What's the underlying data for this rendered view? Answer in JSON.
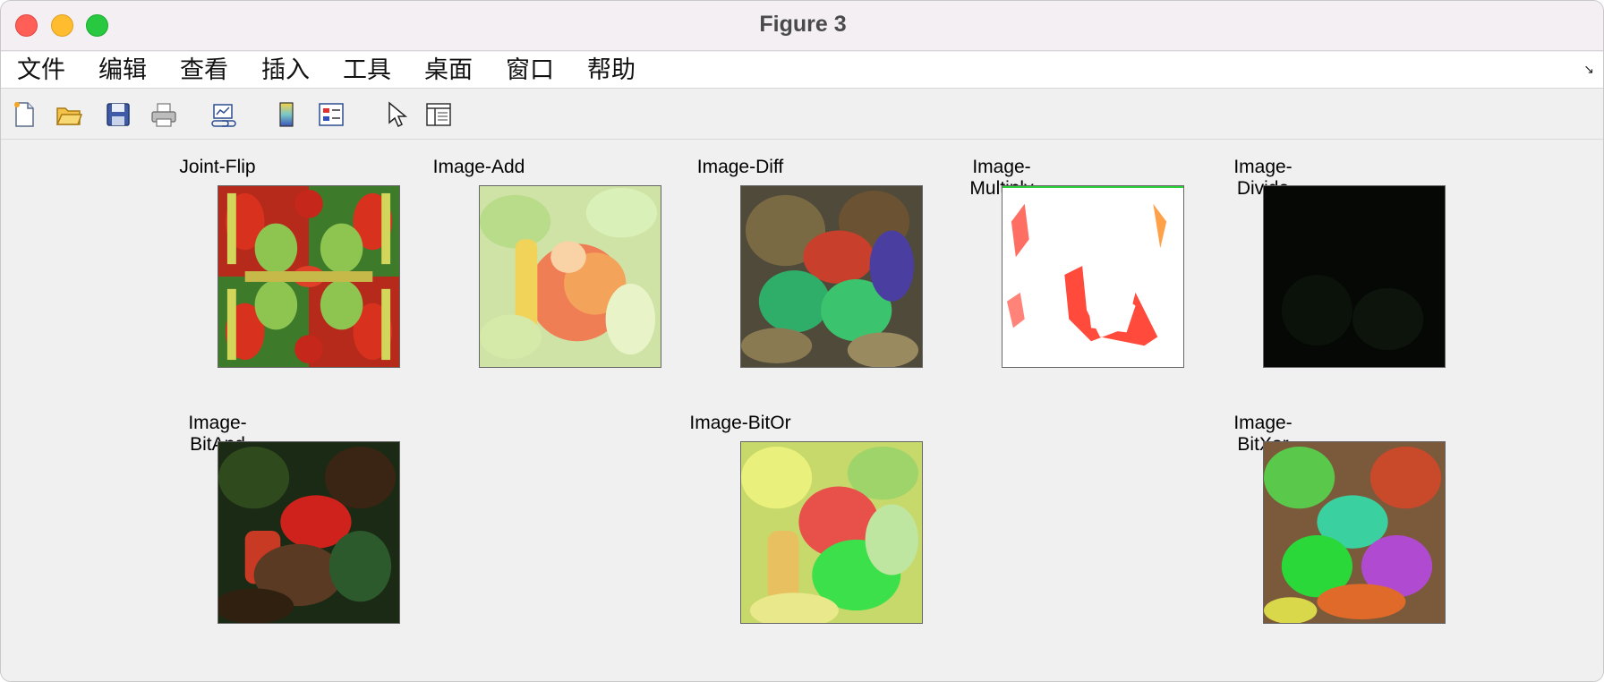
{
  "window": {
    "title": "Figure 3"
  },
  "menu": {
    "items": [
      "文件",
      "编辑",
      "查看",
      "插入",
      "工具",
      "桌面",
      "窗口",
      "帮助"
    ]
  },
  "toolbar": {
    "buttons": [
      {
        "name": "new-figure-icon"
      },
      {
        "name": "open-file-icon"
      },
      {
        "name": "save-icon"
      },
      {
        "name": "print-icon"
      },
      {
        "name": "link-plot-icon"
      },
      {
        "name": "colorbar-icon"
      },
      {
        "name": "legend-icon"
      },
      {
        "name": "edit-plot-pointer-icon"
      },
      {
        "name": "property-inspector-icon"
      }
    ]
  },
  "subplots": [
    {
      "title": "Joint-Flip"
    },
    {
      "title": "Image-Add"
    },
    {
      "title": "Image-Diff"
    },
    {
      "title": "Image-Multiply"
    },
    {
      "title": "Image-Divide"
    },
    {
      "title": "Image-BitAnd"
    },
    {
      "title": "Image-BitOr"
    },
    {
      "title": "Image-BitXor"
    }
  ]
}
